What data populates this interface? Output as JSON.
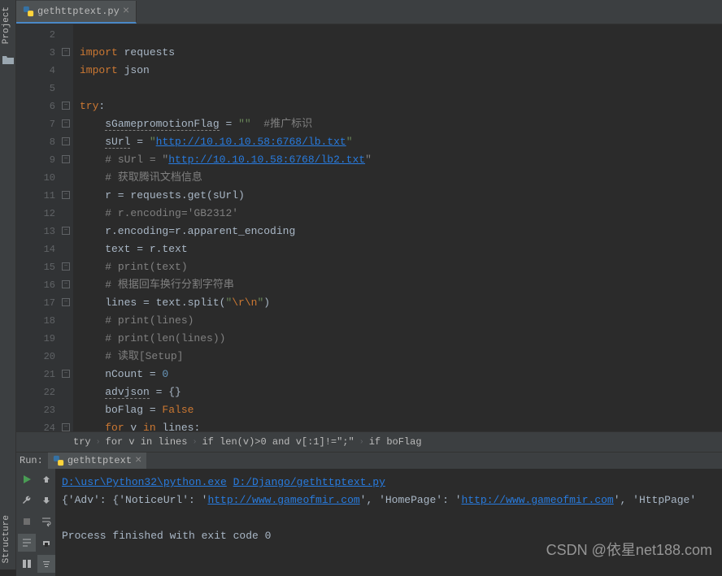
{
  "sidebar": {
    "project_label": "Project",
    "structure_label": "Structure"
  },
  "tabs": [
    {
      "filename": "gethttptext.py",
      "active": true
    }
  ],
  "code": {
    "lines": [
      {
        "n": 2,
        "html": ""
      },
      {
        "n": 3,
        "html": "<span class=\"kw\">import</span> requests"
      },
      {
        "n": 4,
        "html": "<span class=\"kw\">import</span> json"
      },
      {
        "n": 5,
        "html": ""
      },
      {
        "n": 6,
        "html": "<span class=\"kw\">try</span>:"
      },
      {
        "n": 7,
        "html": "    <span class=\"warn\">sGamepromotionFlag</span> = <span class=\"str\">\"\"</span>  <span class=\"comment\">#推广标识</span>"
      },
      {
        "n": 8,
        "html": "    <span class=\"warn\">sUrl</span> = <span class=\"str\">\"</span><span class=\"url\">http://10.10.10.58:6768/lb.txt</span><span class=\"str\">\"</span>"
      },
      {
        "n": 9,
        "html": "    <span class=\"comment\"># sUrl = \"</span><span class=\"url\">http://10.10.10.58:6768/lb2.txt</span><span class=\"comment\">\"</span>"
      },
      {
        "n": 10,
        "html": "    <span class=\"comment\"># 获取腾讯文档信息</span>"
      },
      {
        "n": 11,
        "html": "    r = requests.get(sUrl)"
      },
      {
        "n": 12,
        "html": "    <span class=\"comment\"># r.encoding='GB2312'</span>"
      },
      {
        "n": 13,
        "html": "    r.encoding=r.apparent_encoding"
      },
      {
        "n": 14,
        "html": "    text = r.text"
      },
      {
        "n": 15,
        "html": "    <span class=\"comment\"># print(text)</span>"
      },
      {
        "n": 16,
        "html": "    <span class=\"comment\"># 根据回车换行分割字符串</span>"
      },
      {
        "n": 17,
        "html": "    lines = text.split(<span class=\"str\">\"</span><span class=\"kw\">\\r\\n</span><span class=\"str\">\"</span>)"
      },
      {
        "n": 18,
        "html": "    <span class=\"comment\"># print(lines)</span>"
      },
      {
        "n": 19,
        "html": "    <span class=\"comment\"># print(len(lines))</span>"
      },
      {
        "n": 20,
        "html": "    <span class=\"comment\"># 读取[Setup]</span>"
      },
      {
        "n": 21,
        "html": "    nCount = <span class=\"num\">0</span>"
      },
      {
        "n": 22,
        "html": "    <span class=\"warn\">advjson</span> = {}"
      },
      {
        "n": 23,
        "html": "    boFlag = <span class=\"kw\">False</span>"
      },
      {
        "n": 24,
        "html": "    <span class=\"kw\">for</span> v <span class=\"kw\">in</span> lines:"
      }
    ]
  },
  "breadcrumb": [
    "try",
    "for v in lines",
    "if len(v)>0 and v[:1]!=\";\"",
    "if boFlag"
  ],
  "run": {
    "label": "Run:",
    "config_name": "gethttptext",
    "lines": [
      {
        "type": "cmd",
        "parts": [
          {
            "t": "url",
            "v": "D:\\usr\\Python32\\python.exe"
          },
          {
            "t": "plain",
            "v": " "
          },
          {
            "t": "url",
            "v": "D:/Django/gethttptext.py"
          }
        ]
      },
      {
        "type": "out",
        "parts": [
          {
            "t": "plain",
            "v": "{'Adv': {'NoticeUrl': '"
          },
          {
            "t": "url",
            "v": "http://www.gameofmir.com"
          },
          {
            "t": "plain",
            "v": "', 'HomePage': '"
          },
          {
            "t": "url",
            "v": "http://www.gameofmir.com"
          },
          {
            "t": "plain",
            "v": "', 'HttpPage'"
          }
        ]
      },
      {
        "type": "blank"
      },
      {
        "type": "out",
        "parts": [
          {
            "t": "plain",
            "v": "Process finished with exit code 0"
          }
        ]
      }
    ]
  },
  "watermark": "CSDN @依星net188.com"
}
